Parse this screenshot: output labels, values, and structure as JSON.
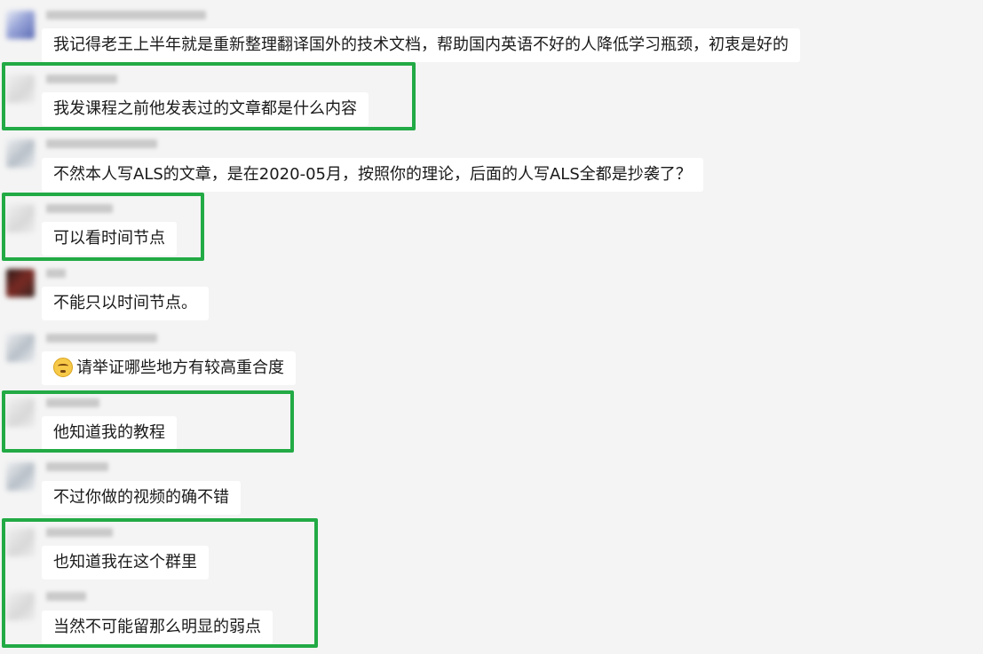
{
  "messages": [
    {
      "text": "我记得老王上半年就是重新整理翻译国外的技术文档，帮助国内英语不好的人降低学习瓶颈，初衷是好的",
      "avatar": "avatar-blue"
    },
    {
      "text": "我发课程之前他发表过的文章都是什么内容",
      "avatar": "avatar-light"
    },
    {
      "text": "不然本人写ALS的文章，是在2020-05月，按照你的理论，后面的人写ALS全都是抄袭了？",
      "avatar": "avatar-grey"
    },
    {
      "text": "可以看时间节点",
      "avatar": "avatar-light"
    },
    {
      "text": "不能只以时间节点。",
      "avatar": "avatar-dark"
    },
    {
      "text": "请举证哪些地方有较高重合度",
      "avatar": "avatar-grey",
      "emoji": "rolling-eyes-emoji"
    },
    {
      "text": "他知道我的教程",
      "avatar": "avatar-light"
    },
    {
      "text": "不过你做的视频的确不错",
      "avatar": "avatar-grey"
    },
    {
      "text": "也知道我在这个群里",
      "avatar": "avatar-light"
    },
    {
      "text": "当然不可能留那么明显的弱点",
      "avatar": "avatar-light"
    }
  ],
  "colors": {
    "background": "#f4f4f4",
    "bubble": "#ffffff",
    "highlight": "#22aa45",
    "text": "#1a1a1a"
  }
}
